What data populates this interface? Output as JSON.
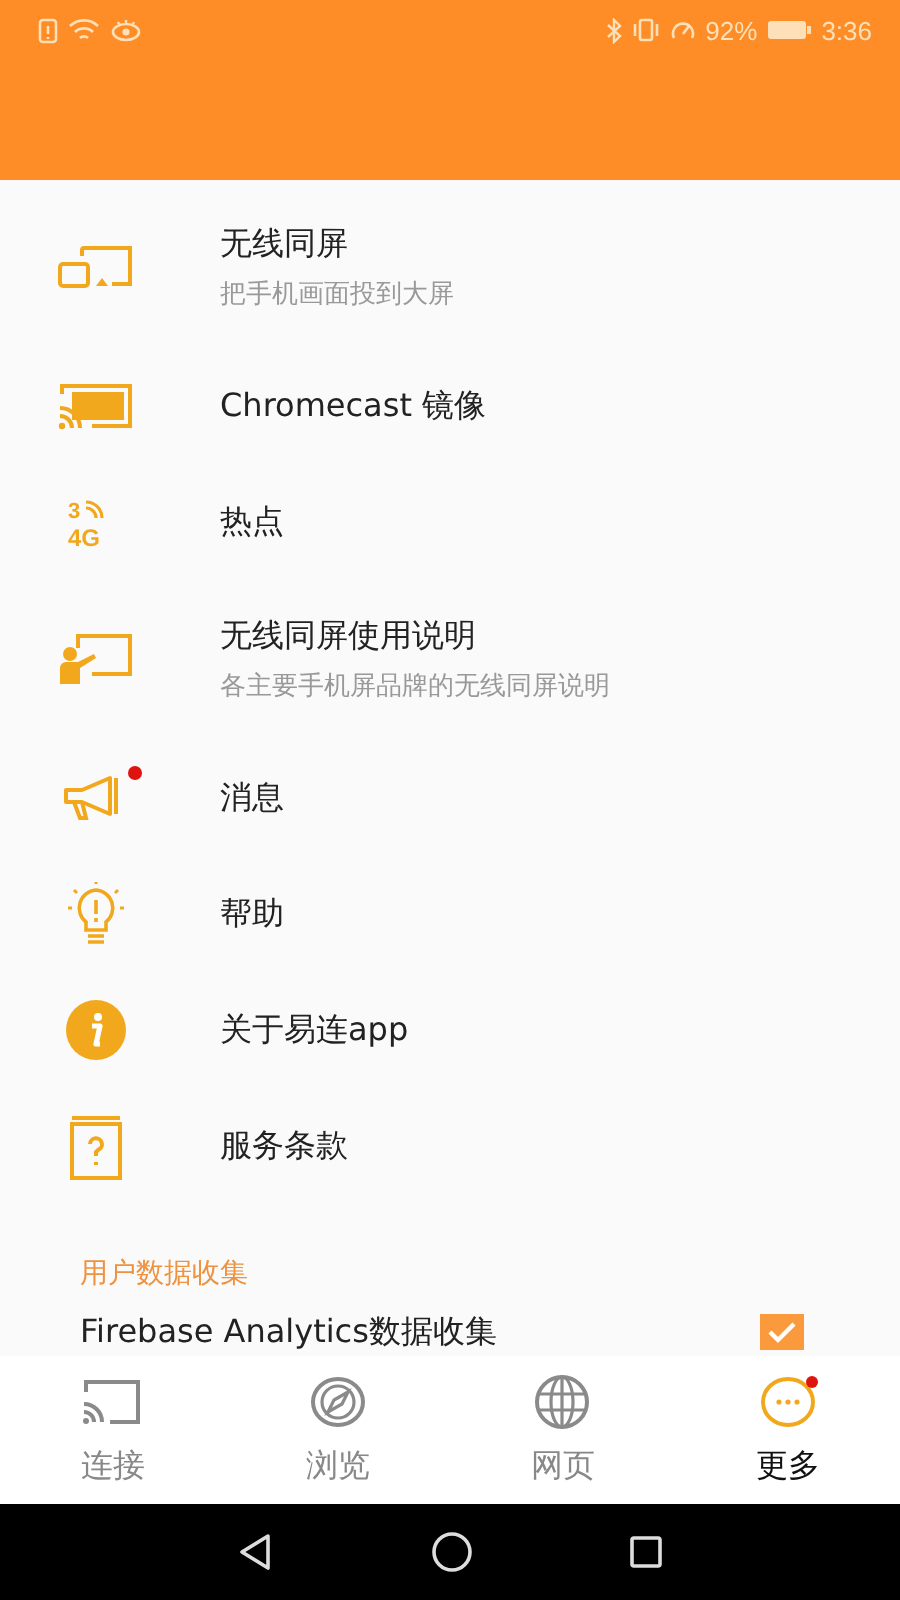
{
  "status_bar": {
    "battery_text": "92%",
    "time": "3:36"
  },
  "menu": [
    {
      "kind": "screens",
      "title": "无线同屏",
      "subtitle": "把手机画面投到大屏",
      "badge": false
    },
    {
      "kind": "cast",
      "title": "Chromecast 镜像",
      "badge": false
    },
    {
      "kind": "network",
      "icon_texts": [
        "3",
        "4G"
      ],
      "title": "热点",
      "badge": false
    },
    {
      "kind": "teacher",
      "title": "无线同屏使用说明",
      "subtitle": "各主要手机屏品牌的无线同屏说明",
      "badge": false
    },
    {
      "kind": "megaphone",
      "title": "消息",
      "badge": true
    },
    {
      "kind": "bulb",
      "title": "帮助",
      "badge": false
    },
    {
      "kind": "info",
      "title": "关于易连app",
      "badge": false
    },
    {
      "kind": "book",
      "title": "服务条款",
      "badge": false
    }
  ],
  "section": {
    "title": "用户数据收集",
    "setting": {
      "label": "Firebase Analytics数据收集",
      "checked": true
    }
  },
  "bottom_nav": [
    {
      "kind": "cast",
      "label": "连接",
      "selected": false,
      "badge": false
    },
    {
      "kind": "compass",
      "label": "浏览",
      "selected": false,
      "badge": false
    },
    {
      "kind": "globe",
      "label": "网页",
      "selected": false,
      "badge": false
    },
    {
      "kind": "more",
      "label": "更多",
      "selected": true,
      "badge": true
    }
  ]
}
